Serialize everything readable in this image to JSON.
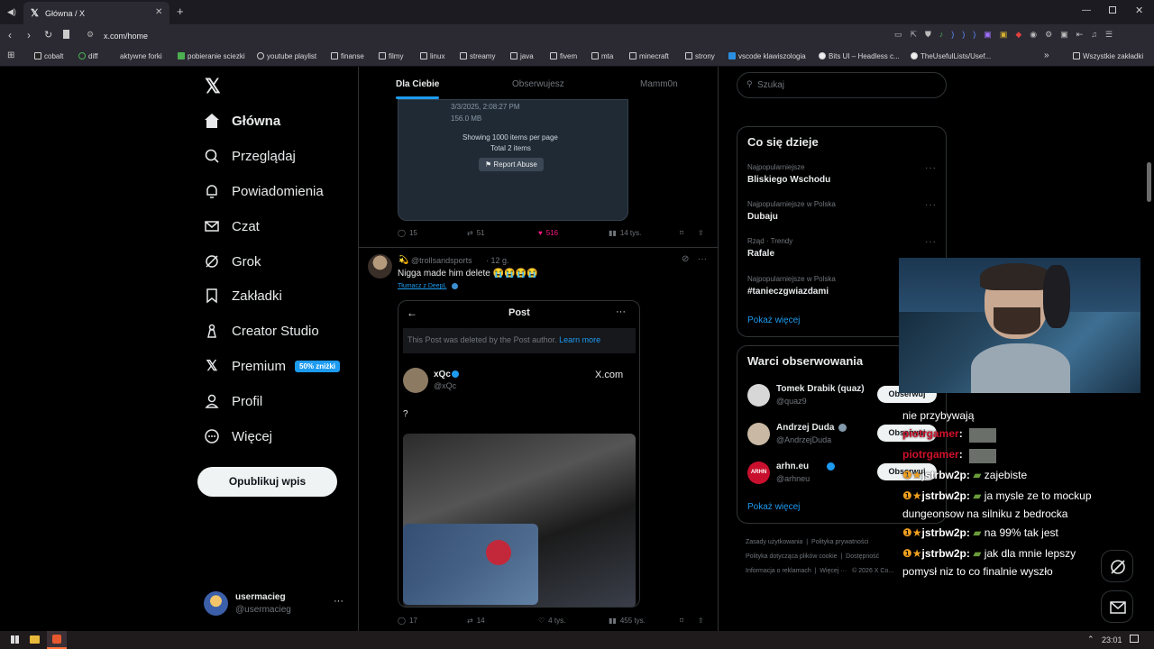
{
  "browser": {
    "tab_title": "Główna / X",
    "url": "x.com/home",
    "bookmarks": [
      "cobalt",
      "diff",
      "aktywne forki",
      "pobieranie sciezki",
      "youtube playlist",
      "finanse",
      "filmy",
      "linux",
      "streamy",
      "java",
      "fivem",
      "mta",
      "minecraft",
      "strony",
      "vscode klawiszologia",
      "Bits UI – Headless c...",
      "TheUsefulLists/Usef..."
    ],
    "all_bookmarks": "Wszystkie zakładki"
  },
  "nav": {
    "items": [
      "Główna",
      "Przeglądaj",
      "Powiadomienia",
      "Czat",
      "Grok",
      "Zakładki",
      "Creator Studio",
      "Premium",
      "Profil",
      "Więcej"
    ],
    "premium_badge": "50% zniżki",
    "post_button": "Opublikuj wpis",
    "user_name": "usermacieg",
    "user_handle": "@usermacieg"
  },
  "feed": {
    "tabs": [
      "Dla Ciebie",
      "Obserwujesz",
      "Mamm0n"
    ],
    "post1": {
      "embed_date": "3/3/2025, 2:08:27 PM",
      "embed_size": "156.0 MB",
      "embed_line1": "Showing 1000 items per page",
      "embed_line2": "Total 2 items",
      "embed_button": "Report Abuse",
      "replies": "15",
      "reposts": "51",
      "likes": "516",
      "views": "14 tys."
    },
    "post2": {
      "handle": "@trollsandsports",
      "time": "· 12 g.",
      "text": "Nigga made him delete 😭😭😭😭",
      "translate": "Tłumacz z DeepL",
      "card_title": "Post",
      "card_notice": "This Post was deleted by the Post author.",
      "card_learn": "Learn more",
      "card_author": "xQc",
      "card_handle": "@xQc",
      "card_site": "X.com",
      "card_text": "?",
      "replies": "17",
      "reposts": "14",
      "likes": "4 tys.",
      "views": "455 tys."
    }
  },
  "right": {
    "search_placeholder": "Szukaj",
    "trends_title": "Co się dzieje",
    "trends": [
      {
        "meta": "Najpopularniejsze",
        "name": "Bliskiego Wschodu"
      },
      {
        "meta": "Najpopularniejsze w Polska",
        "name": "Dubaju"
      },
      {
        "meta": "Rząd · Trendy",
        "name": "Rafale"
      },
      {
        "meta": "Najpopularniejsze w Polska",
        "name": "#tanieczgwiazdami"
      }
    ],
    "show_more": "Pokaż więcej",
    "follow_title": "Warci obserwowania",
    "follow": [
      {
        "name": "Tomek Drabik (quaz)",
        "handle": "@quaz9"
      },
      {
        "name": "Andrzej Duda",
        "handle": "@AndrzejDuda"
      },
      {
        "name": "arhn.eu",
        "handle": "@arhneu"
      }
    ],
    "follow_button": "Obserwuj",
    "footer": [
      "Zasady użytkowania",
      "Polityka prywatności",
      "Polityka dotycząca plików cookie",
      "Dostępność",
      "Informacja o reklamach",
      "Więcej ···",
      "© 2026 X Co..."
    ]
  },
  "chat": {
    "lines": [
      {
        "user": "",
        "text": "nie przybywają"
      },
      {
        "user": "piotrgamer",
        "text": ""
      },
      {
        "user": "piotrgamer",
        "text": ""
      },
      {
        "user": "jstrbw2p",
        "text": "zajebiste"
      },
      {
        "user": "jstrbw2p",
        "text": "ja mysle ze to mockup"
      },
      {
        "user": "",
        "text": "dungeonsow na silniku z bedrocka"
      },
      {
        "user": "jstrbw2p",
        "text": "na 99% tak jest"
      },
      {
        "user": "jstrbw2p",
        "text": "jak dla mnie lepszy"
      },
      {
        "user": "",
        "text": "pomysł niz to co finalnie wyszło"
      }
    ]
  },
  "taskbar": {
    "time": "23:01"
  }
}
